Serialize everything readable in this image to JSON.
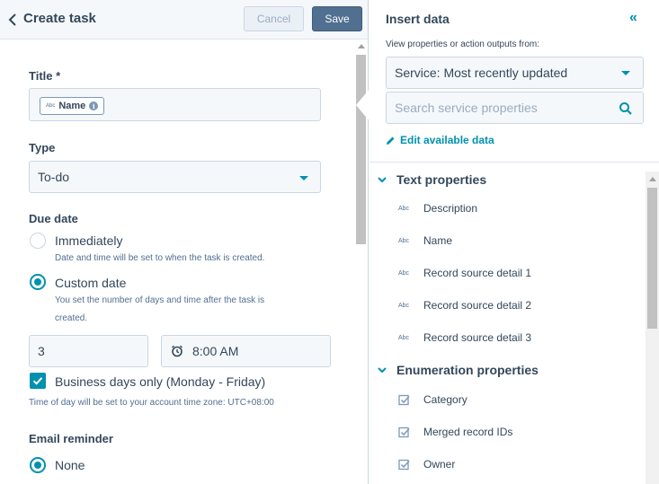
{
  "left": {
    "title": "Create task",
    "cancel_label": "Cancel",
    "save_label": "Save",
    "title_label": "Title *",
    "title_token": {
      "type_tag": "Abc",
      "name": "Name",
      "info": "i"
    },
    "type_label": "Type",
    "type_value": "To-do",
    "due_label": "Due date",
    "immediately_label": "Immediately",
    "immediately_help": "Date and time will be set to when the task is created.",
    "custom_label": "Custom date",
    "custom_help_1": "You set the number of days and time after the task is",
    "custom_help_2": "created.",
    "days_value": "3",
    "time_value": "8:00 AM",
    "business_days_label": "Business days only (Monday - Friday)",
    "timezone_note": "Time of day will be set to your account time zone: UTC+08:00",
    "email_label": "Email reminder",
    "none_label": "None"
  },
  "right": {
    "title": "Insert data",
    "collapse_glyph": "«",
    "subtitle": "View properties or action outputs from:",
    "source_value": "Service: Most recently updated",
    "search_placeholder": "Search service properties",
    "edit_link": "Edit available data",
    "sections": [
      {
        "title": "Text properties",
        "items": [
          {
            "tag": "Abc",
            "label": "Description"
          },
          {
            "tag": "Abc",
            "label": "Name"
          },
          {
            "tag": "Abc",
            "label": "Record source detail 1"
          },
          {
            "tag": "Abc",
            "label": "Record source detail 2"
          },
          {
            "tag": "Abc",
            "label": "Record source detail 3"
          }
        ]
      },
      {
        "title": "Enumeration properties",
        "items": [
          {
            "label": "Category"
          },
          {
            "label": "Merged record IDs"
          },
          {
            "label": "Owner"
          }
        ]
      }
    ]
  },
  "colors": {
    "accent": "#0091ae",
    "text": "#33475b",
    "save": "#516f90"
  }
}
